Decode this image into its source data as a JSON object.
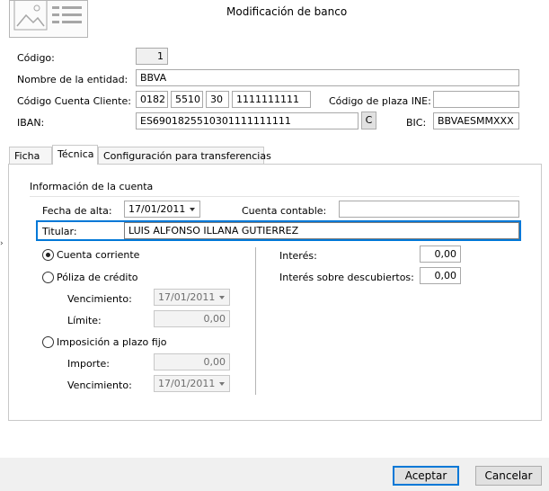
{
  "window": {
    "title": "Modificación de banco"
  },
  "form": {
    "codigo_label": "Código:",
    "codigo_value": "1",
    "nombre_label": "Nombre de la entidad:",
    "nombre_value": "BBVA",
    "ccc_label": "Código Cuenta Cliente:",
    "ccc_entidad": "0182",
    "ccc_oficina": "5510",
    "ccc_dc": "30",
    "ccc_cuenta": "1111111111",
    "plaza_label": "Código de plaza INE:",
    "plaza_value": "",
    "iban_label": "IBAN:",
    "iban_value": "ES6901825510301111111111",
    "iban_button": "C",
    "bic_label": "BIC:",
    "bic_value": "BBVAESMMXXX"
  },
  "tabs": [
    {
      "label": "Ficha"
    },
    {
      "label": "Técnica"
    },
    {
      "label": "Configuración para transferencias"
    }
  ],
  "tecnica": {
    "section_title": "Información de la cuenta",
    "fecha_alta_label": "Fecha de alta:",
    "fecha_alta_value": "17/01/2011",
    "cuenta_contable_label": "Cuenta contable:",
    "cuenta_contable_value": "",
    "titular_label": "Titular:",
    "titular_value": "LUIS ALFONSO ILLANA GUTIERREZ",
    "options": {
      "corriente": "Cuenta corriente",
      "poliza": "Póliza de crédito",
      "imposicion": "Imposición a plazo fijo"
    },
    "selected_option": "Cuenta corriente",
    "poliza_vencimiento_label": "Vencimiento:",
    "poliza_vencimiento_value": "17/01/2011",
    "poliza_limite_label": "Límite:",
    "poliza_limite_value": "0,00",
    "imp_importe_label": "Importe:",
    "imp_importe_value": "0,00",
    "imp_vencimiento_label": "Vencimiento:",
    "imp_vencimiento_value": "17/01/2011",
    "interes_label": "Interés:",
    "interes_value": "0,00",
    "interes_desc_label": "Interés sobre descubiertos:",
    "interes_desc_value": "0,00"
  },
  "footer": {
    "accept": "Aceptar",
    "cancel": "Cancelar"
  },
  "colors": {
    "focus_border": "#0078d7",
    "footer_bg": "#f0f0f0"
  }
}
